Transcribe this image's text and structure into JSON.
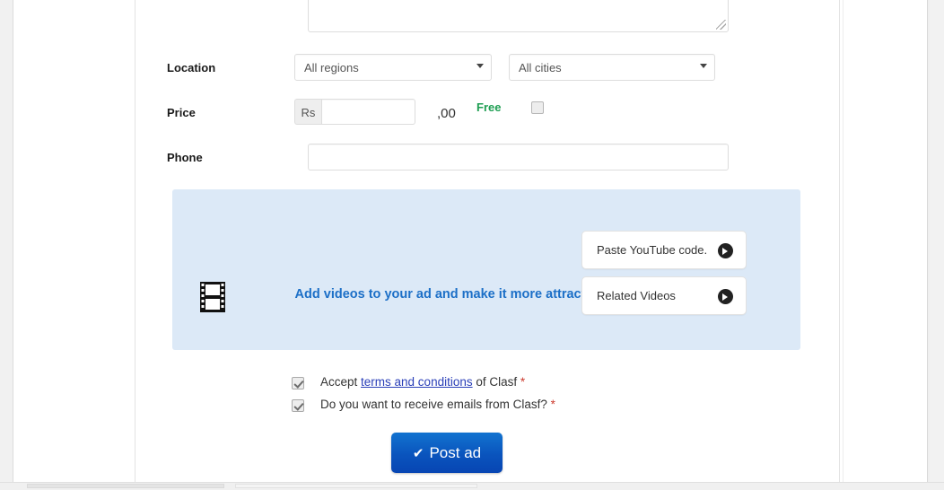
{
  "form": {
    "description_field": {
      "name": "description-textarea",
      "value": "",
      "placeholder": ""
    },
    "location": {
      "label": "Location",
      "region_select": {
        "selected": "All regions",
        "options": [
          "All regions"
        ]
      },
      "city_select": {
        "selected": "All cities",
        "options": [
          "All cities"
        ]
      }
    },
    "price": {
      "label": "Price",
      "currency_addon": "Rs",
      "value": "",
      "placeholder": "",
      "cents_suffix": ",00",
      "free_label": "Free",
      "free_checked": false
    },
    "phone": {
      "label": "Phone",
      "value": "",
      "placeholder": ""
    }
  },
  "video_panel": {
    "headline": "Add videos to your ad and make it more attractive!",
    "icon": "film-strip-icon",
    "buttons": [
      {
        "label": "Paste YouTube code.",
        "icon": "arrow-right-circle-icon"
      },
      {
        "label": "Related Videos",
        "icon": "arrow-right-circle-icon"
      }
    ],
    "background_color": "#dce9f7",
    "headline_color": "#1c6fc7"
  },
  "terms": [
    {
      "checked": true,
      "prefix": "Accept ",
      "link": "terms and conditions",
      "suffix": " of Clasf ",
      "required_marker": "*"
    },
    {
      "checked": true,
      "prefix": "Do you want to receive emails from Clasf? ",
      "link": "",
      "suffix": "",
      "required_marker": "*"
    }
  ],
  "submit": {
    "label": "Post ad",
    "check_glyph": "✔",
    "color": "#0a54bd"
  },
  "colors": {
    "page_background": "#ffffff",
    "chrome_background": "#efefef",
    "free_green": "#1e9e52",
    "link_blue": "#2a3fb8",
    "required_red": "#cc3b2e"
  }
}
